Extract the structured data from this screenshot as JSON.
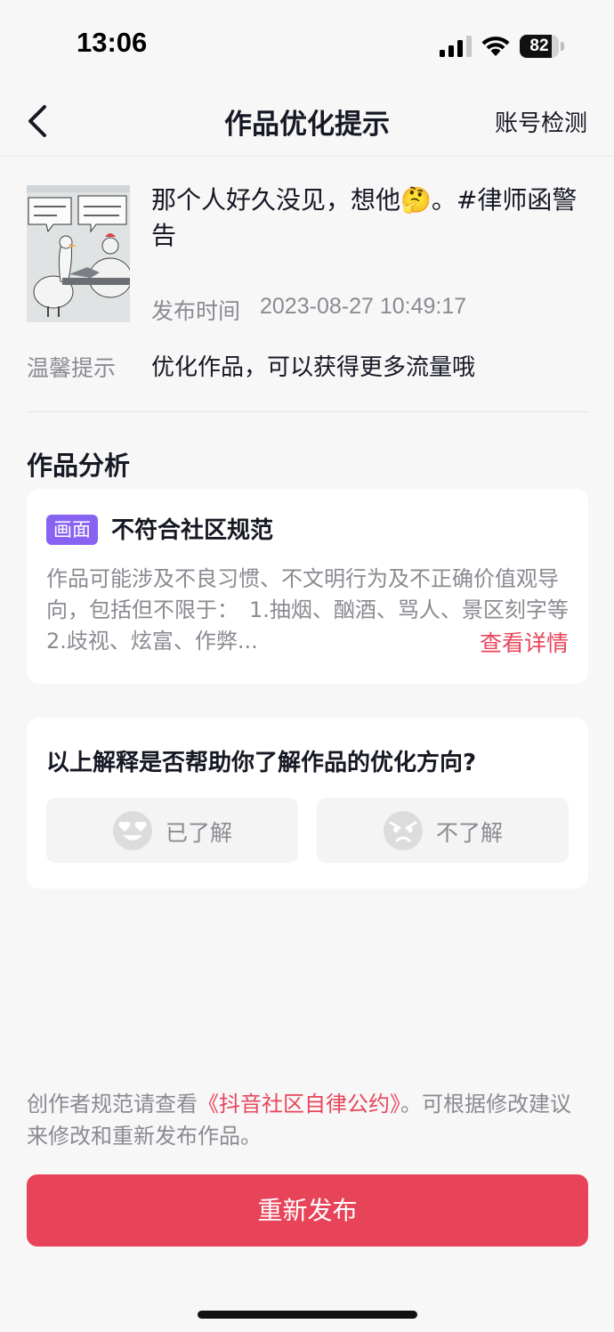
{
  "status_bar": {
    "time": "13:06",
    "battery_level": "82",
    "battery_fraction": 0.82
  },
  "nav": {
    "title": "作品优化提示",
    "right_action": "账号检测",
    "back_icon": "chevron-left-icon"
  },
  "post": {
    "title": "那个人好久没见，想他🤔。#律师函警告",
    "time_label": "发布时间",
    "time_value": "2023-08-27 10:49:17",
    "tip_label": "温馨提示",
    "tip_value": "优化作品，可以获得更多流量哦"
  },
  "analysis": {
    "section_title": "作品分析",
    "tag": "画面",
    "violation_title": "不符合社区规范",
    "description": "作品可能涉及不良习惯、不文明行为及不正确价值观导向，包括但不限于：　1.抽烟、酗酒、骂人、景区刻字等　2.歧视、炫富、作弊...",
    "detail_link": "查看详情",
    "accent_color": "#8863f2"
  },
  "feedback": {
    "question": "以上解释是否帮助你了解作品的优化方向?",
    "yes_label": "已了解",
    "no_label": "不了解",
    "yes_icon": "heart-eyes-emoji-icon",
    "no_icon": "angry-emoji-icon"
  },
  "footer": {
    "note_prefix": "创作者规范请查看",
    "note_link": "《抖音社区自律公约》",
    "note_suffix": "。可根据修改建议来修改和重新发布作品。",
    "republish_label": "重新发布",
    "brand_color": "#e84459"
  }
}
